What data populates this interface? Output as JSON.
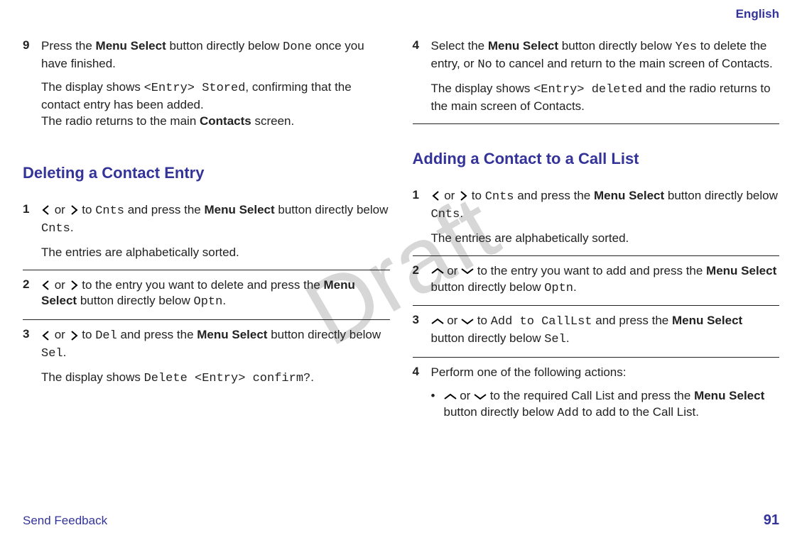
{
  "lang": "English",
  "watermark": "Draft",
  "footer": {
    "feedback": "Send Feedback",
    "page": "91"
  },
  "left": {
    "step9": {
      "n": "9",
      "p1a": "Press the ",
      "p1b": "Menu Select",
      "p1c": " button directly below ",
      "p1d": "Done",
      "p1e": " once you have finished.",
      "p2a": "The display shows ",
      "p2b": "<Entry> Stored",
      "p2c": ", confirming that the contact entry has been added.",
      "p2d": "The radio returns to the main ",
      "p2e": "Contacts",
      "p2f": " screen."
    },
    "h_delete": "Deleting a Contact Entry",
    "d1": {
      "n": "1",
      "p1a": " or ",
      "p1b": " to ",
      "p1c": "Cnts",
      "p1d": " and press the ",
      "p1e": "Menu Select",
      "p1f": " button directly below ",
      "p1g": "Cnts",
      "p1h": ".",
      "p2": "The entries are alphabetically sorted."
    },
    "d2": {
      "n": "2",
      "p1a": " or ",
      "p1b": " to the entry you want to delete and press the ",
      "p1c": "Menu Select",
      "p1d": " button directly below ",
      "p1e": "Optn",
      "p1f": "."
    },
    "d3": {
      "n": "3",
      "p1a": " or ",
      "p1b": " to ",
      "p1c": "Del",
      "p1d": " and press the ",
      "p1e": "Menu Select",
      "p1f": " button directly below ",
      "p1g": "Sel",
      "p1h": ".",
      "p2a": "The display shows ",
      "p2b": "Delete <Entry> confirm?",
      "p2c": "."
    }
  },
  "right": {
    "step4": {
      "n": "4",
      "p1a": "Select the ",
      "p1b": "Menu Select",
      "p1c": " button directly below ",
      "p1d": "Yes",
      "p1e": " to delete the entry, or ",
      "p1f": "No",
      "p1g": " to cancel and return to the main screen of Contacts.",
      "p2a": "The display shows ",
      "p2b": "<Entry> deleted",
      "p2c": " and the radio returns to the main screen of Contacts."
    },
    "h_add": "Adding a Contact to a Call List",
    "a1": {
      "n": "1",
      "p1a": " or ",
      "p1b": " to ",
      "p1c": "Cnts",
      "p1d": " and press the ",
      "p1e": "Menu Select",
      "p1f": " button directly below ",
      "p1g": "Cnts",
      "p1h": ".",
      "p2": "The entries are alphabetically sorted."
    },
    "a2": {
      "n": "2",
      "p1a": " or ",
      "p1b": " to the entry you want to add and press the ",
      "p1c": "Menu Select",
      "p1d": " button directly below ",
      "p1e": "Optn",
      "p1f": "."
    },
    "a3": {
      "n": "3",
      "p1a": " or ",
      "p1b": " to ",
      "p1c": "Add to CallLst",
      "p1d": " and press the ",
      "p1e": "Menu Select",
      "p1f": " button directly below ",
      "p1g": "Sel",
      "p1h": "."
    },
    "a4": {
      "n": "4",
      "p1": "Perform one of the following actions:",
      "bul": {
        "mark": "•",
        "t1": " or ",
        "t2": " to the required Call List and press the ",
        "t3": "Menu Select",
        "t4": " button directly below ",
        "t5": "Add",
        "t6": " to add to the Call List."
      }
    }
  }
}
